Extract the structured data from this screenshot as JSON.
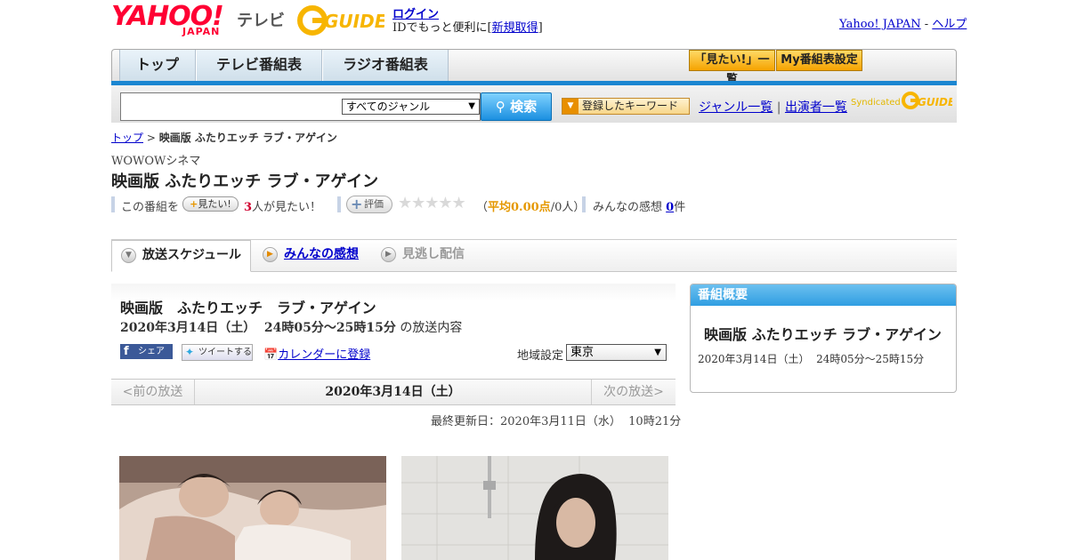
{
  "header": {
    "yahoo_logo": "YAHOO!",
    "japan_logo": "JAPAN",
    "tv_label": "テレビ",
    "gguide_logo": "G-GUIDE",
    "login_link": "ログイン",
    "login_sub_prefix": "IDでもっと便利に[",
    "signup_link": "新規取得",
    "login_sub_suffix": "]",
    "yahoo_japan_link": "Yahoo! JAPAN",
    "separator": "-",
    "help_link": "ヘルプ"
  },
  "nav": {
    "tabs": [
      {
        "label": "トップ"
      },
      {
        "label": "テレビ番組表"
      },
      {
        "label": "ラジオ番組表"
      }
    ],
    "mitai_list_btn": "「見たい!」一覧",
    "my_schedule_btn": "My番組表設定"
  },
  "search": {
    "input_value": "",
    "genre_selected": "すべてのジャンル",
    "search_btn": "検索",
    "keyword_btn": "登録したキーワード",
    "genre_list_link": "ジャンル一覧",
    "divider": "|",
    "performer_link": "出演者一覧",
    "syndicated": "Syndicated"
  },
  "breadcrumb": {
    "top_link": "トップ",
    "sep": ">",
    "current": "映画版 ふたりエッチ ラブ・アゲイン"
  },
  "program": {
    "channel": "WOWOWシネマ",
    "title": "映画版 ふたりエッチ ラブ・アゲイン",
    "stats": {
      "mitai_prefix": "この番組を",
      "mitai_btn": "見たい!",
      "mitai_count": "3",
      "mitai_suffix": "人が見たい！",
      "hyoka_btn": "評価",
      "stars": "★★★★★",
      "avg_open": "（",
      "avg_value": "平均0.00点",
      "avg_people": "/0人）",
      "kanso_label": "みんなの感想",
      "kanso_count": "0",
      "kanso_unit": "件"
    }
  },
  "tabs": {
    "schedule": "放送スケジュール",
    "kanso": "みんなの感想",
    "missed": "見逃し配信"
  },
  "schedule_card": {
    "title": "映画版　ふたりエッチ　ラブ・アゲイン",
    "date_time": "2020年3月14日（土）  24時05分～25時15分",
    "suffix": " の放送内容",
    "share_btn": "シェア",
    "tweet_btn": "ツイートする",
    "calendar_link": "カレンダーに登録",
    "region_label": "地域設定",
    "region_value": "東京",
    "prev_btn": "<前の放送",
    "current_date": "2020年3月14日（土）",
    "next_btn": "次の放送>",
    "updated": "最終更新日：2020年3月11日（水）  10時21分"
  },
  "overview": {
    "header": "番組概要",
    "title": "映画版 ふたりエッチ ラブ・アゲイン",
    "time": "2020年3月14日（土）  24時05分～25時15分"
  },
  "colors": {
    "brand_red": "#ff0033",
    "accent_blue": "#1b86d1",
    "accent_orange": "#f5a300"
  }
}
